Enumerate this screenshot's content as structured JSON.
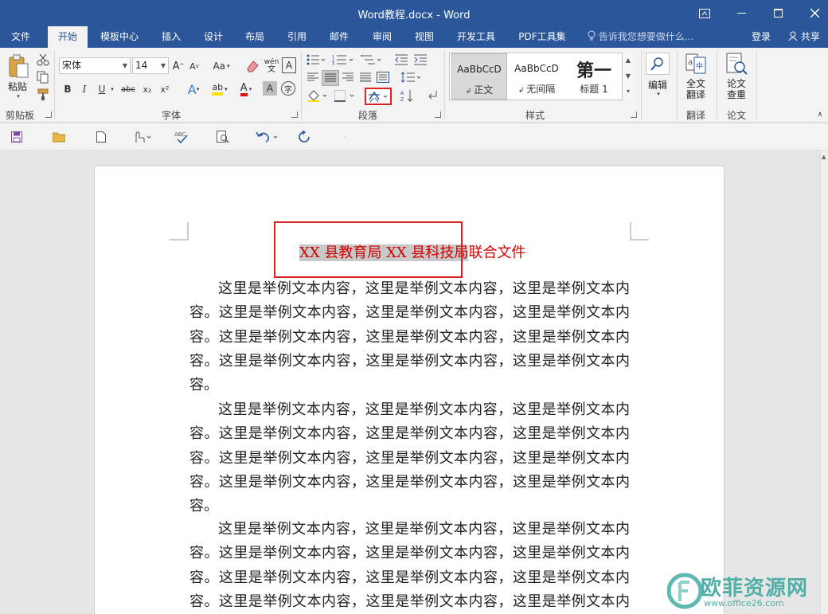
{
  "window": {
    "title": "Word教程.docx - Word",
    "controls": [
      "restore-ribbon",
      "minimize",
      "maximize",
      "close"
    ]
  },
  "tabs": [
    "文件",
    "开始",
    "模板中心",
    "插入",
    "设计",
    "布局",
    "引用",
    "邮件",
    "审阅",
    "视图",
    "开发工具",
    "PDF工具集"
  ],
  "active_tab": "开始",
  "tell_me": "告诉我您想要做什么...",
  "account": {
    "login": "登录",
    "share": "共享"
  },
  "ribbon": {
    "clipboard": {
      "label": "剪贴板",
      "paste": "粘贴"
    },
    "font": {
      "label": "字体",
      "font_name": "宋体",
      "font_size": "14",
      "grow": "A",
      "shrink": "A",
      "change_case": "Aa",
      "bold": "B",
      "italic": "I",
      "underline": "U",
      "strike": "abc",
      "subscript": "x₂",
      "superscript": "x²",
      "phonetic": "wén",
      "border_char": "A",
      "effects": "A",
      "highlight": "ab",
      "font_color": "A",
      "shading": "A",
      "enclose": "字"
    },
    "paragraph": {
      "label": "段落"
    },
    "styles": {
      "label": "样式",
      "items": [
        {
          "sample": "AaBbCcD",
          "name": "正文"
        },
        {
          "sample": "AaBbCcD",
          "name": "无间隔"
        },
        {
          "sample": "第一",
          "name": "标题 1"
        }
      ]
    },
    "editing": {
      "label": "编辑"
    },
    "translate": {
      "button": "全文\n翻译",
      "label": "翻译"
    },
    "paper": {
      "button": "论文\n查重",
      "label": "论文"
    }
  },
  "document": {
    "title_highlighted": "XX 县教育局 XX 县科技局",
    "title_rest": "联合文件",
    "paragraphs": [
      "这里是举例文本内容，这里是举例文本内容，这里是举例文本内容。这里是举例文本内容，这里是举例文本内容，这里是举例文本内容。这里是举例文本内容，这里是举例文本内容，这里是举例文本内容。这里是举例文本内容，这里是举例文本内容，这里是举例文本内容。",
      "这里是举例文本内容，这里是举例文本内容，这里是举例文本内容。这里是举例文本内容，这里是举例文本内容，这里是举例文本内容。这里是举例文本内容，这里是举例文本内容，这里是举例文本内容。这里是举例文本内容，这里是举例文本内容，这里是举例文本内容。",
      "这里是举例文本内容，这里是举例文本内容，这里是举例文本内容。这里是举例文本内容，这里是举例文本内容，这里是举例文本内容。这里是举例文本内容，这里是举例文本内容，这里是举例文本内容。这里是举例文本内容，这里是举例文本内容，这里是举例文本内容。"
    ]
  },
  "watermark": {
    "text": "欧菲资源网",
    "url": "www.office26.com"
  },
  "colors": {
    "brand": "#2b579a",
    "title_red": "#d00000",
    "annotation_red": "#d62424"
  }
}
